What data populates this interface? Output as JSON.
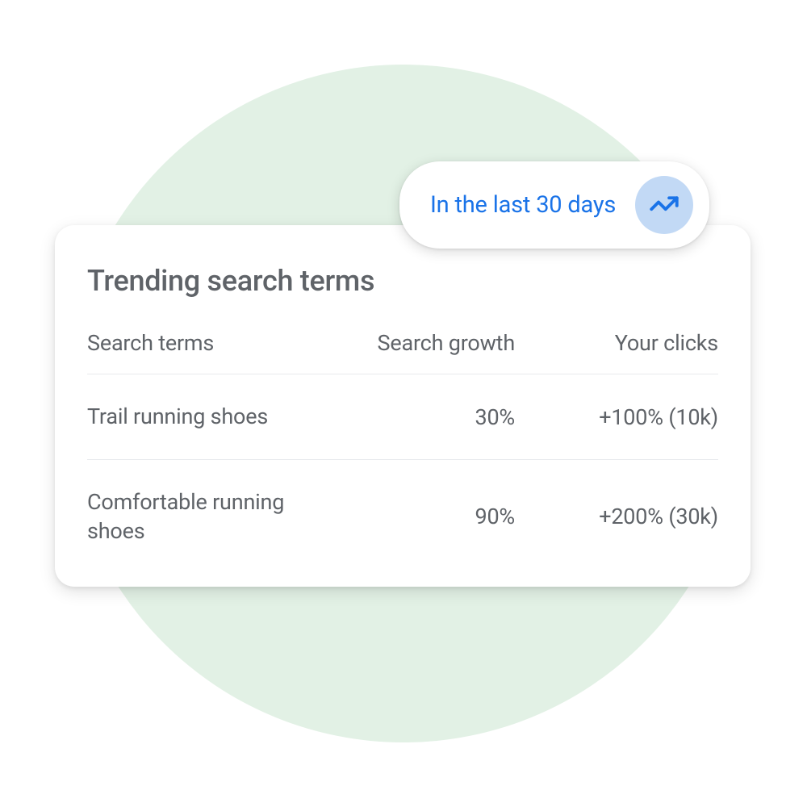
{
  "timeFilter": {
    "label": "In the last 30 days"
  },
  "card": {
    "title": "Trending search terms",
    "columns": {
      "terms": "Search terms",
      "growth": "Search growth",
      "clicks": "Your clicks"
    },
    "rows": [
      {
        "term": "Trail running shoes",
        "growth": "30%",
        "clicks": "+100% (10k)"
      },
      {
        "term": "Comfortable running shoes",
        "growth": "90%",
        "clicks": "+200% (30k)"
      }
    ]
  },
  "colors": {
    "bg_circle": "#e2f1e5",
    "accent_blue": "#1a73e8",
    "icon_bg": "#c2d9f5",
    "text_gray": "#5f6368"
  }
}
